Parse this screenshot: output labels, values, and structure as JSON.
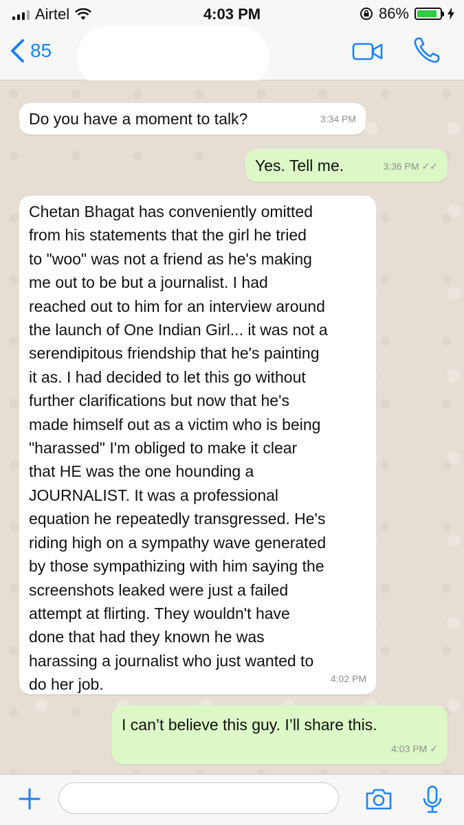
{
  "status_bar": {
    "carrier": "Airtel",
    "time": "4:03 PM",
    "battery_percent": "86%",
    "battery_level": 0.86,
    "icons": [
      "signal-icon",
      "wifi-icon",
      "rotation-lock-icon",
      "battery-icon",
      "charging-icon"
    ]
  },
  "header": {
    "back_count": "85",
    "icons": [
      "chevron-left-icon",
      "video-call-icon",
      "phone-icon"
    ],
    "accent_color": "#1a82fb"
  },
  "messages": [
    {
      "direction": "incoming",
      "text": "Do you have a moment to talk?",
      "time": "3:34 PM"
    },
    {
      "direction": "outgoing",
      "text": "Yes. Tell me.",
      "time": "3:36 PM",
      "status": "read"
    },
    {
      "direction": "incoming",
      "lines": [
        "Chetan Bhagat has conveniently omitted",
        "from his statements that the girl he tried",
        "to \"woo\" was not a friend as he's making",
        "me out to be but a journalist. I had",
        "reached out to him for an interview around",
        "the launch of One Indian Girl... it was not a",
        "serendipitous friendship that he's painting",
        "it as. I had decided to let this go without",
        "further clarifications but now that he's",
        "made himself out as a victim who is being",
        "\"harassed\" I'm obliged to make it clear",
        "that HE was the one hounding a",
        "JOURNALIST. It was a professional",
        "equation he repeatedly transgressed. He's",
        "riding high on a sympathy wave generated",
        "by those sympathizing with him saying the",
        "screenshots leaked were just a failed",
        "attempt at flirting. They wouldn't have",
        "done that had they known he was",
        "harassing a journalist who just wanted to",
        "do her job."
      ],
      "time": "4:02 PM"
    },
    {
      "direction": "outgoing",
      "text": "I can’t believe this guy. I’ll share this.",
      "time": "4:03 PM",
      "status": "sent"
    }
  ],
  "input_bar": {
    "placeholder": "",
    "icons": [
      "plus-icon",
      "camera-icon",
      "microphone-icon"
    ]
  },
  "colors": {
    "incoming_bubble": "#ffffff",
    "outgoing_bubble": "#dcf8c6",
    "chat_background": "#e6ddd4"
  }
}
